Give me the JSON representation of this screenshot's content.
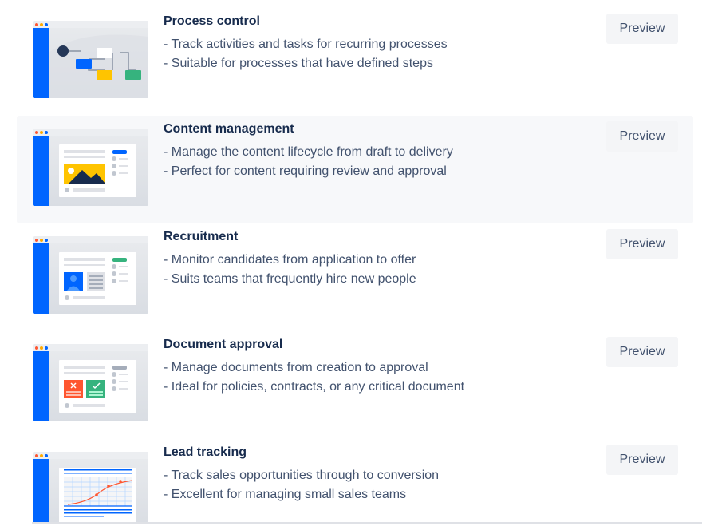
{
  "templates": [
    {
      "title": "Process control",
      "bullets": [
        "- Track activities and tasks for recurring processes",
        "- Suitable for processes that have defined steps"
      ],
      "preview_label": "Preview"
    },
    {
      "title": "Content management",
      "bullets": [
        "- Manage the content lifecycle from draft to delivery",
        "- Perfect for content requiring review and approval"
      ],
      "preview_label": "Preview"
    },
    {
      "title": "Recruitment",
      "bullets": [
        "- Monitor candidates from application to offer",
        "- Suits teams that frequently hire new people"
      ],
      "preview_label": "Preview"
    },
    {
      "title": "Document approval",
      "bullets": [
        "- Manage documents from creation to approval",
        "- Ideal for policies, contracts, or any critical document"
      ],
      "preview_label": "Preview"
    },
    {
      "title": "Lead tracking",
      "bullets": [
        "- Track sales opportunities through to conversion",
        "- Excellent for managing small sales teams"
      ],
      "preview_label": "Preview"
    }
  ],
  "hovered_index": 1,
  "colors": {
    "accent_blue": "#0065ff",
    "green": "#36b37e",
    "yellow": "#ffc400",
    "red": "#ff5630"
  }
}
